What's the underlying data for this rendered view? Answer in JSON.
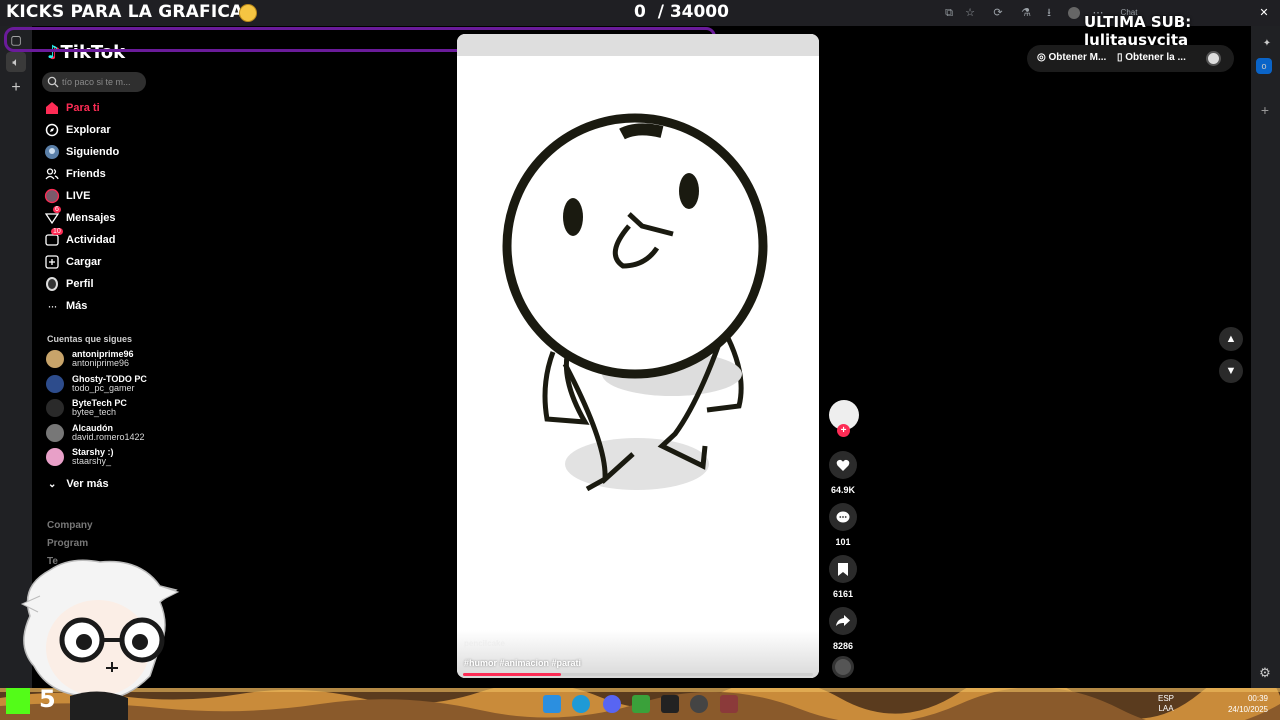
{
  "stream": {
    "title": "KICKS PARA LA GRAFICA",
    "counter_current": "0",
    "counter_goal": "/ 34000",
    "last_sub": "ULTIMA SUB: lulitausycita"
  },
  "browser": {
    "chat_label": "Chat"
  },
  "tiktok": {
    "logo": "TikTok",
    "search_placeholder": "tío paco si te m...",
    "nav": [
      {
        "label": "Para ti",
        "icon": "home-icon"
      },
      {
        "label": "Explorar",
        "icon": "compass-icon"
      },
      {
        "label": "Siguiendo",
        "icon": "following-icon"
      },
      {
        "label": "Friends",
        "icon": "friends-icon"
      },
      {
        "label": "LIVE",
        "icon": "live-icon"
      },
      {
        "label": "Mensajes",
        "icon": "messages-icon",
        "badge": "6"
      },
      {
        "label": "Actividad",
        "icon": "activity-icon",
        "badge": "10"
      },
      {
        "label": "Cargar",
        "icon": "upload-icon"
      },
      {
        "label": "Perfil",
        "icon": "profile-icon"
      },
      {
        "label": "Más",
        "icon": "more-icon"
      }
    ],
    "following_title": "Cuentas que sigues",
    "accounts": [
      {
        "name": "antoniprime96",
        "handle": "antoniprime96",
        "color": "#c8a46a"
      },
      {
        "name": "Ghosty-TODO PC",
        "handle": "todo_pc_gamer",
        "color": "#2d4c8c"
      },
      {
        "name": "ByteTech PC",
        "handle": "bytee_tech",
        "color": "#2a2a2a"
      },
      {
        "name": "Alcaudón",
        "handle": "david.romero1422",
        "color": "#777777"
      },
      {
        "name": "Starshy :)",
        "handle": "staarshy_",
        "color": "#e8a0c8"
      }
    ],
    "see_more": "Ver más",
    "footer": [
      "Company",
      "Program",
      "Te"
    ]
  },
  "video": {
    "author": "pencilcake",
    "tags": "#humor #animacion #parati",
    "progress": 0.28,
    "likes": "64.9K",
    "comments": "101",
    "saves": "6161",
    "shares": "8286"
  },
  "topright": {
    "get_btn_1": "Obtener M...",
    "get_btn_2": "Obtener la ..."
  },
  "taskbar": {
    "kick_count": "5",
    "lang_1": "ESP",
    "lang_2": "LAA",
    "time": "00:39",
    "date": "24/10/2025"
  },
  "colors": {
    "accent": "#fe2c55",
    "kick_green": "#53fc18",
    "annotation_purple": "#6a1b9a"
  }
}
